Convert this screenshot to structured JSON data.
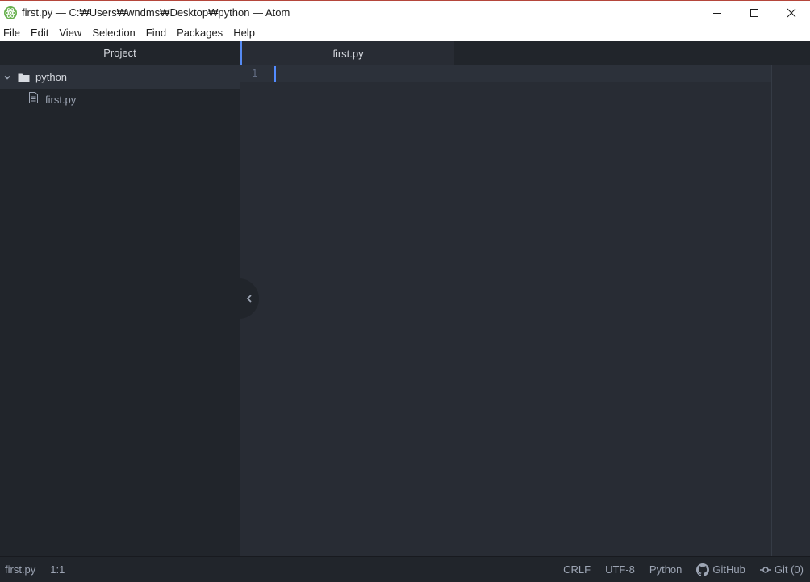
{
  "window": {
    "title": "first.py — C:₩Users₩wndms₩Desktop₩python — Atom",
    "app_icon": "atom-icon",
    "controls": [
      "minimize-icon",
      "maximize-icon",
      "close-icon"
    ]
  },
  "menu": {
    "items": [
      "File",
      "Edit",
      "View",
      "Selection",
      "Find",
      "Packages",
      "Help"
    ]
  },
  "tree": {
    "header": "Project",
    "root": {
      "label": "python",
      "icon": "folder-icon",
      "expanded": true
    },
    "files": [
      {
        "label": "first.py",
        "icon": "file-text-icon"
      }
    ]
  },
  "tabs": [
    {
      "label": "first.py",
      "active": true
    }
  ],
  "editor": {
    "line_numbers": [
      "1"
    ],
    "content": ""
  },
  "status": {
    "file": "first.py",
    "cursor": "1:1",
    "line_ending": "CRLF",
    "encoding": "UTF-8",
    "grammar": "Python",
    "github": "GitHub",
    "git": "Git (0)"
  },
  "colors": {
    "accent": "#568af2",
    "panel_bg": "#21252b",
    "editor_bg": "#282c34",
    "selected_bg": "#2c313a",
    "text": "#d7dae0",
    "muted_text": "#9da5b4"
  }
}
